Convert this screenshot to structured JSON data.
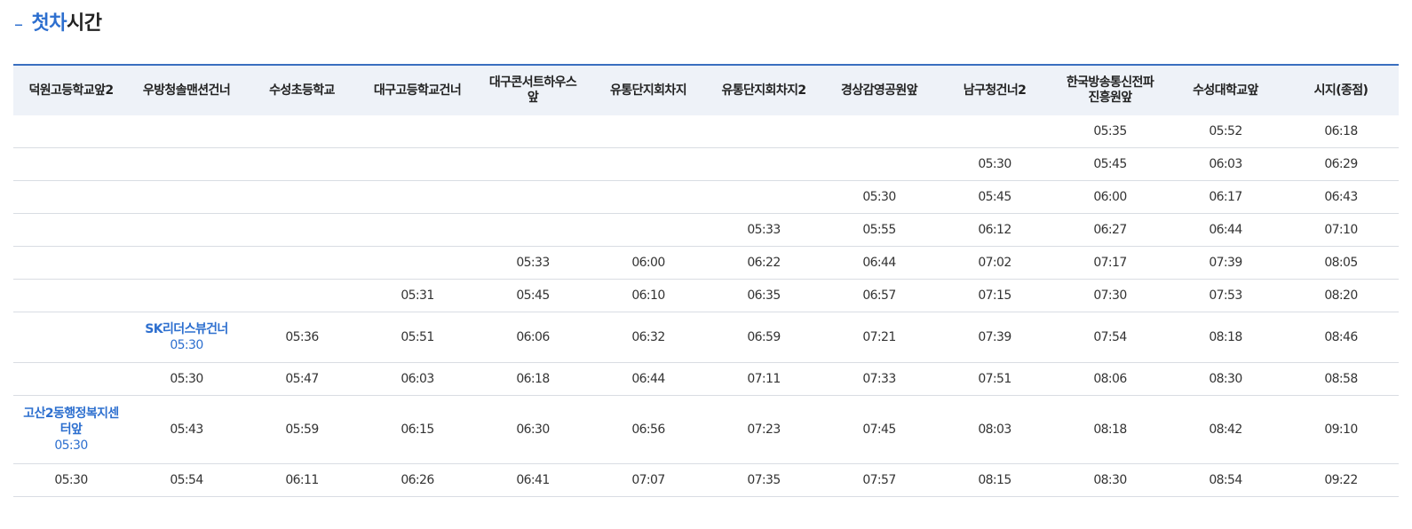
{
  "section": {
    "dash": "–",
    "title_accent": "첫차",
    "title_rest": "시간"
  },
  "columns": [
    "덕원고등학교앞2",
    "우방청솔맨션건너",
    "수성초등학교",
    "대구고등학교건너",
    "대구콘서트하우스앞",
    "유통단지회차지",
    "유통단지회차지2",
    "경상감영공원앞",
    "남구청건너2",
    "한국방송통신전파진흥원앞",
    "수성대학교앞",
    "시지(종점)"
  ],
  "columns_display": [
    [
      "덕원고등학교앞2"
    ],
    [
      "우방청솔맨션건너"
    ],
    [
      "수성초등학교"
    ],
    [
      "대구고등학교건너"
    ],
    [
      "대구콘서트하우스",
      "앞"
    ],
    [
      "유통단지회차지"
    ],
    [
      "유통단지회차지2"
    ],
    [
      "경상감영공원앞"
    ],
    [
      "남구청건너2"
    ],
    [
      "한국방송통신전파",
      "진흥원앞"
    ],
    [
      "수성대학교앞"
    ],
    [
      "시지(종점)"
    ]
  ],
  "rows": [
    {
      "size": "",
      "cells": [
        "",
        "",
        "",
        "",
        "",
        "",
        "",
        "",
        "",
        "05:35",
        "05:52",
        "06:18"
      ]
    },
    {
      "size": "",
      "cells": [
        "",
        "",
        "",
        "",
        "",
        "",
        "",
        "",
        "05:30",
        "05:45",
        "06:03",
        "06:29"
      ]
    },
    {
      "size": "",
      "cells": [
        "",
        "",
        "",
        "",
        "",
        "",
        "",
        "05:30",
        "05:45",
        "06:00",
        "06:17",
        "06:43"
      ]
    },
    {
      "size": "",
      "cells": [
        "",
        "",
        "",
        "",
        "",
        "",
        "05:33",
        "05:55",
        "06:12",
        "06:27",
        "06:44",
        "07:10"
      ]
    },
    {
      "size": "",
      "cells": [
        "",
        "",
        "",
        "",
        "05:33",
        "06:00",
        "06:22",
        "06:44",
        "07:02",
        "07:17",
        "07:39",
        "08:05"
      ]
    },
    {
      "size": "",
      "cells": [
        "",
        "",
        "",
        "05:31",
        "05:45",
        "06:10",
        "06:35",
        "06:57",
        "07:15",
        "07:30",
        "07:53",
        "08:20"
      ]
    },
    {
      "size": "tall",
      "cells": [
        "",
        {
          "stop": "SK리더스뷰건너",
          "time": "05:30"
        },
        "05:36",
        "05:51",
        "06:06",
        "06:32",
        "06:59",
        "07:21",
        "07:39",
        "07:54",
        "08:18",
        "08:46"
      ]
    },
    {
      "size": "",
      "cells": [
        "",
        "05:30",
        "05:47",
        "06:03",
        "06:18",
        "06:44",
        "07:11",
        "07:33",
        "07:51",
        "08:06",
        "08:30",
        "08:58"
      ]
    },
    {
      "size": "taller",
      "cells": [
        {
          "stop_lines": [
            "고산2동행정복지센",
            "터앞"
          ],
          "time": "05:30"
        },
        "05:43",
        "05:59",
        "06:15",
        "06:30",
        "06:56",
        "07:23",
        "07:45",
        "08:03",
        "08:18",
        "08:42",
        "09:10"
      ]
    },
    {
      "size": "",
      "cells": [
        "05:30",
        "05:54",
        "06:11",
        "06:26",
        "06:41",
        "07:07",
        "07:35",
        "07:57",
        "08:15",
        "08:30",
        "08:54",
        "09:22"
      ]
    }
  ],
  "colors": {
    "accent": "#2d6fcf",
    "header_bg": "#eef2f8",
    "header_border": "#3a6fbf",
    "row_border": "#d9dde3"
  }
}
